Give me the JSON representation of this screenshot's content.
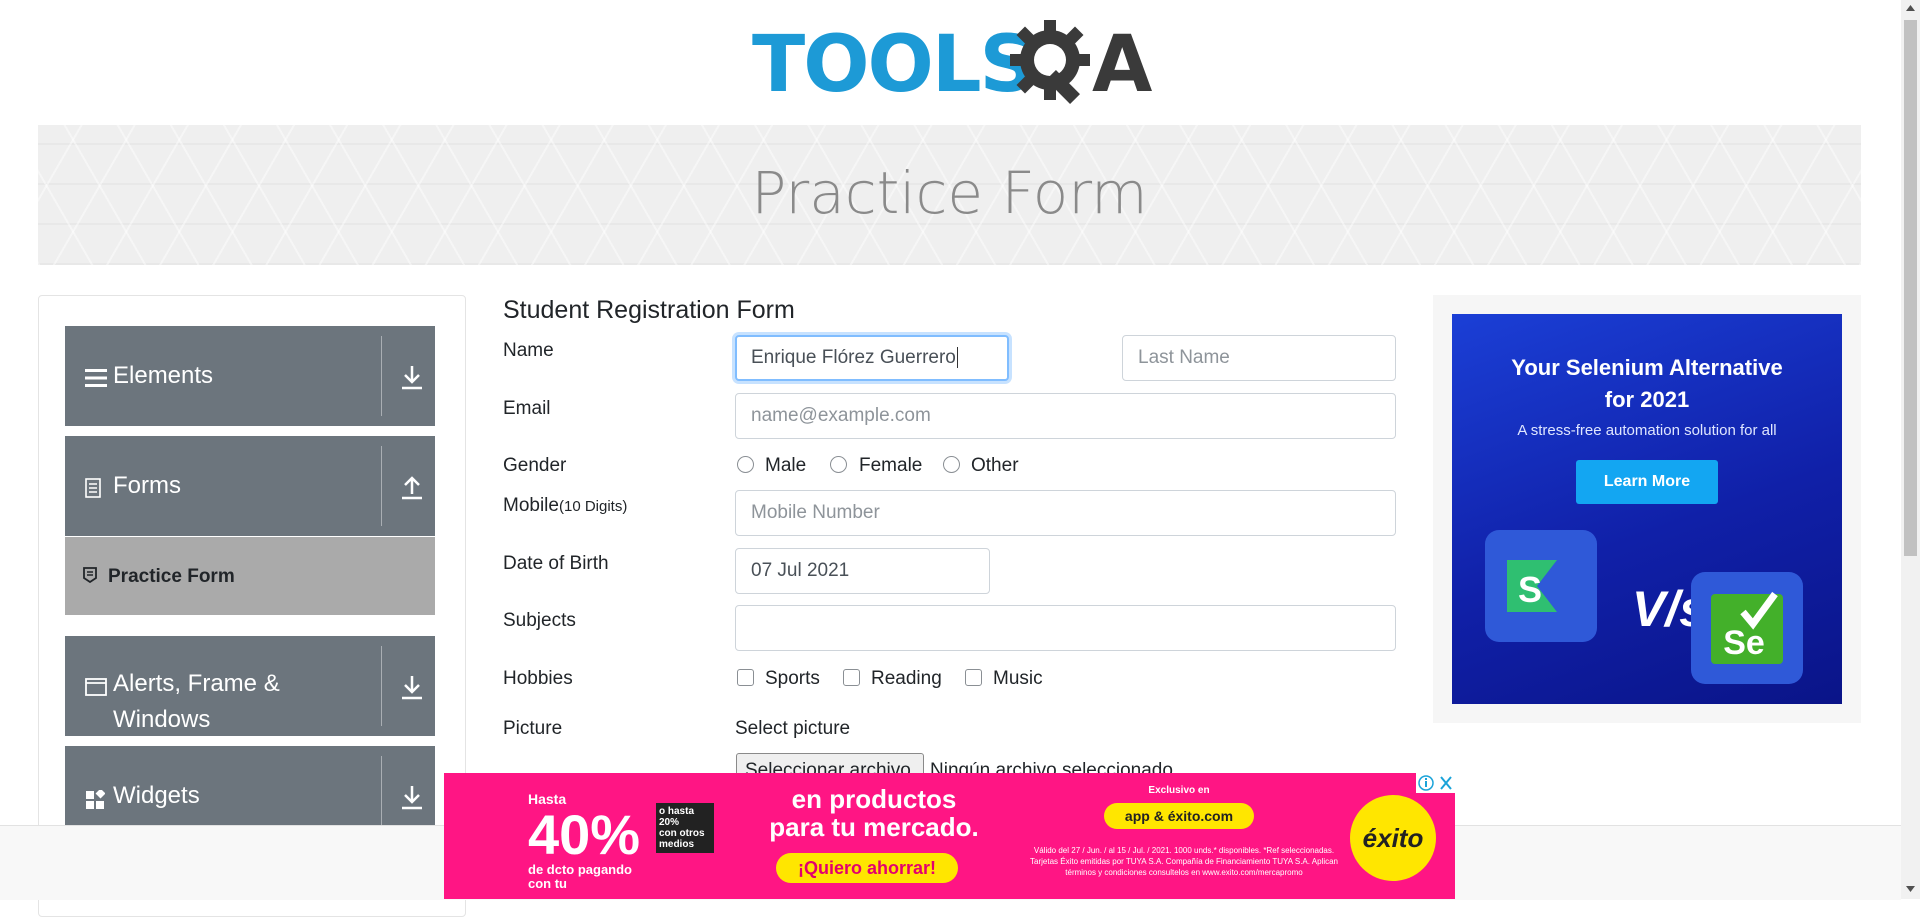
{
  "logo": {
    "brand_text": "TOOLSQA",
    "part1": "TOOLS",
    "part2": "A"
  },
  "banner": {
    "title": "Practice Form"
  },
  "sidebar": {
    "groups": [
      {
        "label": "Elements",
        "icon": "hamburger-icon",
        "arrow": "download-arrow-icon"
      },
      {
        "label": "Forms",
        "icon": "document-icon",
        "arrow": "upload-arrow-icon"
      },
      {
        "label": "Alerts, Frame &",
        "label2": "Windows",
        "icon": "window-icon",
        "arrow": "download-arrow-icon"
      },
      {
        "label": "Widgets",
        "icon": "widgets-icon",
        "arrow": "download-arrow-icon"
      }
    ],
    "active_item": {
      "label": "Practice Form",
      "icon": "form-item-icon"
    }
  },
  "form": {
    "title": "Student Registration Form",
    "name_label": "Name",
    "first_name_value": "Enrique Flórez Guerrero",
    "last_name_placeholder": "Last Name",
    "email_label": "Email",
    "email_placeholder": "name@example.com",
    "gender_label": "Gender",
    "gender_options": [
      "Male",
      "Female",
      "Other"
    ],
    "mobile_label": "Mobile",
    "mobile_hint": "(10 Digits)",
    "mobile_placeholder": "Mobile Number",
    "dob_label": "Date of Birth",
    "dob_value": "07 Jul 2021",
    "subjects_label": "Subjects",
    "subjects_value": "",
    "hobbies_label": "Hobbies",
    "hobbies_options": [
      "Sports",
      "Reading",
      "Music"
    ],
    "picture_label": "Picture",
    "picture_select_label": "Select picture",
    "file_button_label": "Seleccionar archivo",
    "file_status": "Ningún archivo seleccionado"
  },
  "right_ad": {
    "title_line1": "Your Selenium Alternative",
    "title_line2": "for 2021",
    "subtitle": "A stress-free automation solution for all",
    "button": "Learn More",
    "vs": "V/s",
    "logo1": "S",
    "logo2": "Se"
  },
  "bottom_ad": {
    "hasta": "Hasta",
    "percent": "40%",
    "side_note_pct": "o hasta 20%",
    "side_note": "con otros medios",
    "paying": "de dcto pagando con tu",
    "headline1": "en productos",
    "headline2": "para tu mercado.",
    "cta": "¡Quiero ahorrar!",
    "exclusive": "Exclusivo en",
    "app_text": "app & éxito.com",
    "fine_print": "Válido del 27 / Jun. / al 15 / Jul. / 2021. 1000 unds.* disponibles. *Ref seleccionadas. Tarjetas Éxito emitidas por TUYA S.A. Compañía de Financiamiento TUYA S.A. Aplican términos y condiciones consultelos en www.exito.com/mercapromo",
    "logo": "éxito",
    "colors": {
      "bg": "#ff1584",
      "yellow": "#ffe600"
    }
  },
  "colors": {
    "menu_bg": "#6c757d",
    "active_item_bg": "#aaaaaa",
    "logo_blue": "#1d9ad6",
    "focus_border": "#80bdff"
  }
}
